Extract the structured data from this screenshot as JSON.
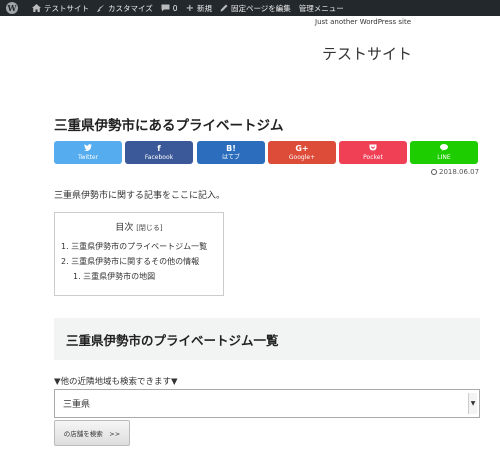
{
  "adminbar": {
    "site_name": "テストサイト",
    "customize": "カスタマイズ",
    "comments_count": "0",
    "new": "新規",
    "edit_page": "固定ページを編集",
    "manage_menu": "管理メニュー"
  },
  "header": {
    "tagline": "Just another WordPress site",
    "site_title": "テストサイト"
  },
  "post": {
    "title": "三重県伊勢市にあるプライベートジム",
    "date": "2018.06.07",
    "intro": "三重県伊勢市に関する記事をここに記入。"
  },
  "share_buttons": [
    {
      "label": "Twitter",
      "icon": "twitter-icon",
      "glyph": "🐦",
      "color": "#55acee"
    },
    {
      "label": "Facebook",
      "icon": "facebook-icon",
      "glyph": "f",
      "color": "#3b5998"
    },
    {
      "label": "はてブ",
      "icon": "hatena-icon",
      "glyph": "B!",
      "color": "#2c6ebd"
    },
    {
      "label": "Google+",
      "icon": "googleplus-icon",
      "glyph": "G+",
      "color": "#dd4b39"
    },
    {
      "label": "Pocket",
      "icon": "pocket-icon",
      "glyph": "♥",
      "color": "#ef4056"
    },
    {
      "label": "LINE",
      "icon": "line-icon",
      "glyph": "●",
      "color": "#1dcd00"
    }
  ],
  "toc": {
    "title": "目次",
    "toggle": "[閉じる]",
    "items": [
      "1. 三重県伊勢市のプライベートジム一覧",
      "2. 三重県伊勢市に関するその他の情報"
    ],
    "subitems": [
      "1. 三重県伊勢市の地図"
    ]
  },
  "section": {
    "heading": "三重県伊勢市のプライベートジム一覧",
    "area_note": "▼他の近隣地域も検索できます▼",
    "select_value": "三重県",
    "search_button": "の店舗を検索　>>"
  }
}
